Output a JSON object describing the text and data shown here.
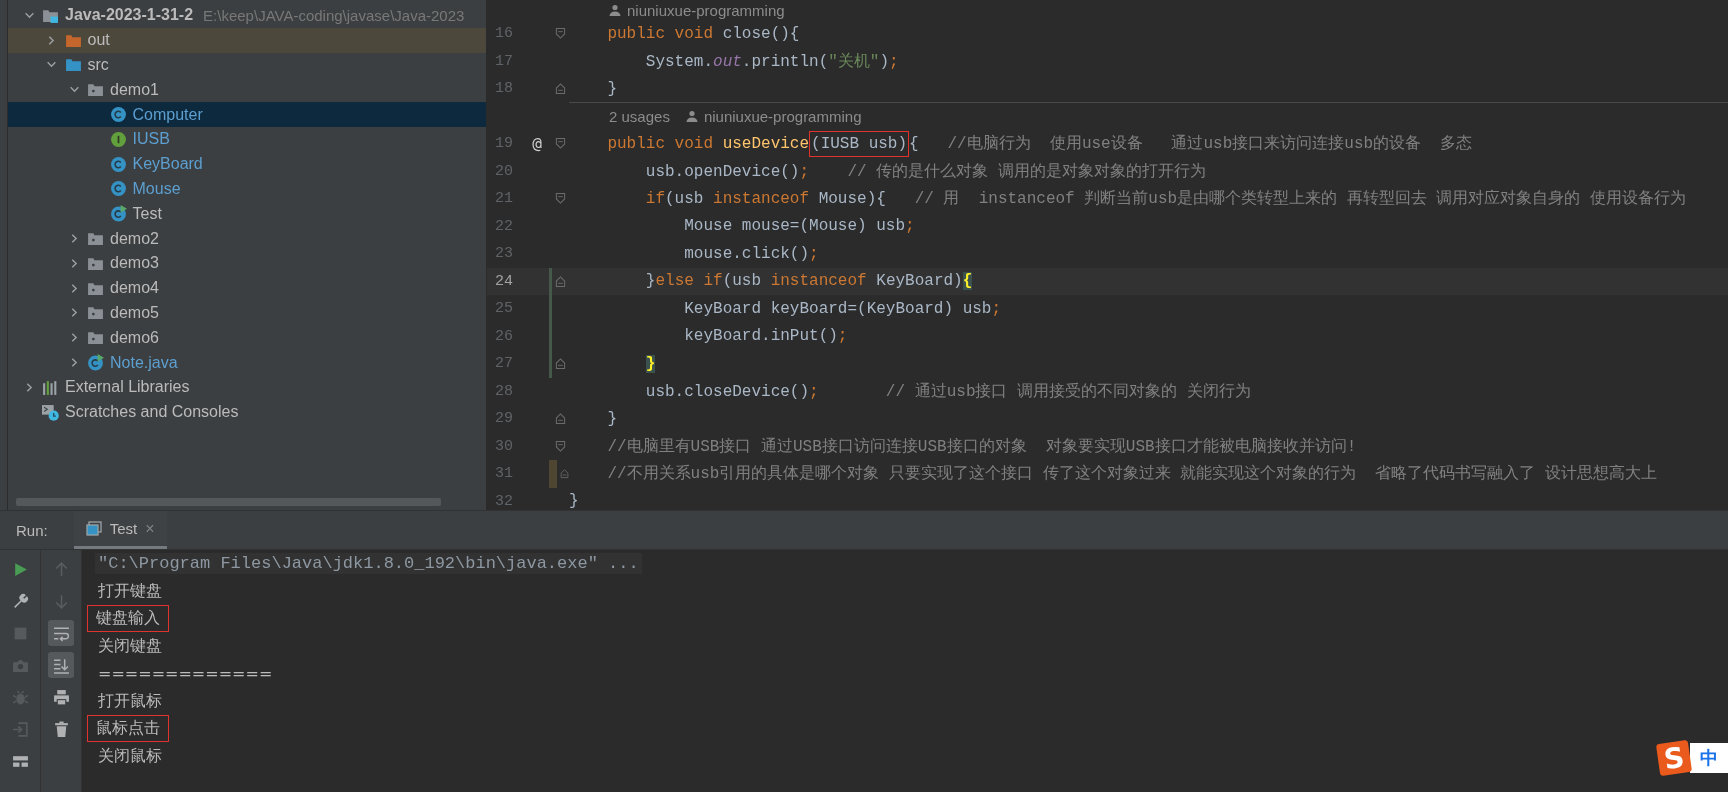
{
  "project_tree": [
    {
      "label": "Java-2023-1-31-2",
      "path": "E:\\keep\\JAVA-coding\\javase\\Java-2023",
      "kind": "project",
      "expanded": true,
      "selected": false,
      "modified": false,
      "children": [
        {
          "label": "out",
          "kind": "excluded-folder",
          "expanded": false,
          "selected": false,
          "modified": false
        },
        {
          "label": "src",
          "kind": "source-folder",
          "expanded": true,
          "selected": false,
          "modified": false,
          "children": [
            {
              "label": "demo1",
              "kind": "package",
              "expanded": true,
              "selected": false,
              "modified": false,
              "children": [
                {
                  "label": "Computer",
                  "kind": "class",
                  "selected": true,
                  "modified": true
                },
                {
                  "label": "IUSB",
                  "kind": "interface",
                  "selected": false,
                  "modified": true
                },
                {
                  "label": "KeyBoard",
                  "kind": "class",
                  "selected": false,
                  "modified": true
                },
                {
                  "label": "Mouse",
                  "kind": "class",
                  "selected": false,
                  "modified": true
                },
                {
                  "label": "Test",
                  "kind": "main-class",
                  "selected": false,
                  "modified": false
                }
              ]
            },
            {
              "label": "demo2",
              "kind": "package",
              "expanded": false,
              "selected": false,
              "modified": false
            },
            {
              "label": "demo3",
              "kind": "package",
              "expanded": false,
              "selected": false,
              "modified": false
            },
            {
              "label": "demo4",
              "kind": "package",
              "expanded": false,
              "selected": false,
              "modified": false
            },
            {
              "label": "demo5",
              "kind": "package",
              "expanded": false,
              "selected": false,
              "modified": false
            },
            {
              "label": "demo6",
              "kind": "package",
              "expanded": false,
              "selected": false,
              "modified": false
            },
            {
              "label": "Note.java",
              "kind": "main-class",
              "expanded": false,
              "selected": false,
              "modified": true
            }
          ]
        }
      ]
    },
    {
      "label": "External Libraries",
      "kind": "library",
      "expanded": false,
      "selected": false,
      "modified": false
    },
    {
      "label": "Scratches and Consoles",
      "kind": "scratches",
      "selected": false,
      "modified": false
    }
  ],
  "editor": {
    "lines": [
      {
        "kind": "inlay",
        "author": "niuniuxue-programming"
      },
      {
        "kind": "code",
        "number": "16",
        "current": false,
        "fold_start": true,
        "segments": [
          {
            "text": "    public void ",
            "kind": "keyword"
          },
          {
            "text": "close(){",
            "kind": "plain"
          }
        ]
      },
      {
        "kind": "code",
        "number": "17",
        "current": false,
        "segments": [
          {
            "text": "        System.",
            "kind": "plain"
          },
          {
            "text": "out",
            "kind": "static"
          },
          {
            "text": ".println(",
            "kind": "plain"
          },
          {
            "text": "\"关机\"",
            "kind": "string"
          },
          {
            "text": ")",
            "kind": "plain"
          },
          {
            "text": ";",
            "kind": "keyword"
          }
        ]
      },
      {
        "kind": "code",
        "number": "18",
        "current": false,
        "fold_end": true,
        "separator": true,
        "segments": [
          {
            "text": "    }",
            "kind": "plain"
          }
        ]
      },
      {
        "kind": "inlay",
        "usages": "2 usages",
        "author": "niuniuxue-programming"
      },
      {
        "kind": "code",
        "number": "19",
        "current": false,
        "marker": "@",
        "fold_start": true,
        "segments": [
          {
            "text": "    public void ",
            "kind": "keyword"
          },
          {
            "text": "useDevice",
            "kind": "method"
          },
          {
            "text": "(IUSB usb)",
            "kind": "plain",
            "boxed": true
          },
          {
            "text": "{",
            "kind": "plain"
          },
          {
            "text": "   //电脑行为  使用use设备   通过usb接口来访问连接usb的设备  多态",
            "kind": "comment"
          }
        ]
      },
      {
        "kind": "code",
        "number": "20",
        "current": false,
        "segments": [
          {
            "text": "        usb.openDevice()",
            "kind": "plain"
          },
          {
            "text": ";",
            "kind": "keyword"
          },
          {
            "text": "    // 传的是什么对象 调用的是对象对象的打开行为",
            "kind": "comment"
          }
        ]
      },
      {
        "kind": "code",
        "number": "21",
        "current": false,
        "fold_start": true,
        "segments": [
          {
            "text": "        if",
            "kind": "keyword"
          },
          {
            "text": "(usb ",
            "kind": "plain"
          },
          {
            "text": "instanceof",
            "kind": "keyword"
          },
          {
            "text": " Mouse){",
            "kind": "plain"
          },
          {
            "text": "   // 用  instanceof 判断当前usb是由哪个类转型上来的 再转型回去 调用对应对象自身的 使用设备行为",
            "kind": "comment"
          }
        ]
      },
      {
        "kind": "code",
        "number": "22",
        "current": false,
        "segments": [
          {
            "text": "            Mouse mouse=(Mouse) usb",
            "kind": "plain"
          },
          {
            "text": ";",
            "kind": "keyword"
          }
        ]
      },
      {
        "kind": "code",
        "number": "23",
        "current": false,
        "segments": [
          {
            "text": "            mouse.click()",
            "kind": "plain"
          },
          {
            "text": ";",
            "kind": "keyword"
          }
        ]
      },
      {
        "kind": "code",
        "number": "24",
        "current": true,
        "fold_end": true,
        "changed": true,
        "segments": [
          {
            "text": "        }",
            "kind": "plain"
          },
          {
            "text": "else if",
            "kind": "keyword"
          },
          {
            "text": "(usb ",
            "kind": "plain"
          },
          {
            "text": "instanceof",
            "kind": "keyword"
          },
          {
            "text": " KeyBoard)",
            "kind": "plain"
          },
          {
            "text": "{",
            "kind": "match"
          }
        ]
      },
      {
        "kind": "code",
        "number": "25",
        "current": false,
        "changed": true,
        "segments": [
          {
            "text": "            KeyBoard keyBoard=(KeyBoard) usb",
            "kind": "plain"
          },
          {
            "text": ";",
            "kind": "keyword"
          }
        ]
      },
      {
        "kind": "code",
        "number": "26",
        "current": false,
        "changed": true,
        "segments": [
          {
            "text": "            keyBoard.inPut()",
            "kind": "plain"
          },
          {
            "text": ";",
            "kind": "keyword"
          }
        ]
      },
      {
        "kind": "code",
        "number": "27",
        "current": false,
        "fold_end": true,
        "changed": true,
        "segments": [
          {
            "text": "        }",
            "kind": "match"
          }
        ]
      },
      {
        "kind": "code",
        "number": "28",
        "current": false,
        "segments": [
          {
            "text": "        usb.closeDevice()",
            "kind": "plain"
          },
          {
            "text": ";",
            "kind": "keyword"
          },
          {
            "text": "       // 通过usb接口 调用接受的不同对象的 关闭行为",
            "kind": "comment"
          }
        ]
      },
      {
        "kind": "code",
        "number": "29",
        "current": false,
        "fold_end": true,
        "segments": [
          {
            "text": "    }",
            "kind": "plain"
          }
        ]
      },
      {
        "kind": "code",
        "number": "30",
        "current": false,
        "fold_start": true,
        "segments": [
          {
            "text": "    //电脑里有USB接口 通过USB接口访问连接USB接口的对象  对象要实现USB接口才能被电脑接收并访问!",
            "kind": "comment"
          }
        ]
      },
      {
        "kind": "code",
        "number": "31",
        "current": false,
        "fold_end": true,
        "marked": true,
        "segments": [
          {
            "text": "    //不用关系usb引用的具体是哪个对象 只要实现了这个接口 传了这个对象过来 就能实现这个对象的行为  省略了代码书写融入了 设计思想高大上",
            "kind": "comment"
          }
        ]
      },
      {
        "kind": "code",
        "number": "32",
        "current": false,
        "segments": [
          {
            "text": "}",
            "kind": "plain"
          }
        ]
      }
    ]
  },
  "run_panel": {
    "label": "Run:",
    "tabs": [
      {
        "label": "Test",
        "close": "×",
        "selected": true
      }
    ],
    "left_tools": [
      {
        "kind": "run",
        "disabled": false
      },
      {
        "kind": "wrench",
        "disabled": false
      },
      {
        "kind": "stop",
        "disabled": true
      },
      {
        "kind": "camera",
        "disabled": true
      },
      {
        "kind": "bug",
        "disabled": true
      },
      {
        "kind": "exit",
        "disabled": true
      },
      {
        "kind": "layout",
        "disabled": false
      }
    ],
    "right_tools": [
      {
        "kind": "up",
        "selected": false,
        "disabled": true
      },
      {
        "kind": "down",
        "selected": false,
        "disabled": true
      },
      {
        "kind": "wrap",
        "selected": true,
        "disabled": false
      },
      {
        "kind": "scroll-end",
        "selected": true,
        "disabled": false
      },
      {
        "kind": "print",
        "selected": false,
        "disabled": false
      },
      {
        "kind": "trash",
        "selected": false,
        "disabled": false
      }
    ],
    "output": [
      {
        "kind": "command",
        "text": "\"C:\\Program Files\\Java\\jdk1.8.0_192\\bin\\java.exe\" ...",
        "boxed": false
      },
      {
        "kind": "stdout",
        "text": "打开键盘",
        "boxed": false
      },
      {
        "kind": "stdout",
        "text": "键盘输入",
        "boxed": true
      },
      {
        "kind": "stdout",
        "text": "关闭键盘",
        "boxed": false
      },
      {
        "kind": "stdout",
        "text": "=============",
        "boxed": false
      },
      {
        "kind": "stdout",
        "text": "打开鼠标",
        "boxed": false
      },
      {
        "kind": "stdout",
        "text": "鼠标点击",
        "boxed": true
      },
      {
        "kind": "stdout",
        "text": "关闭鼠标",
        "boxed": false
      }
    ]
  },
  "ime": {
    "logo": "S",
    "mode": "中"
  }
}
